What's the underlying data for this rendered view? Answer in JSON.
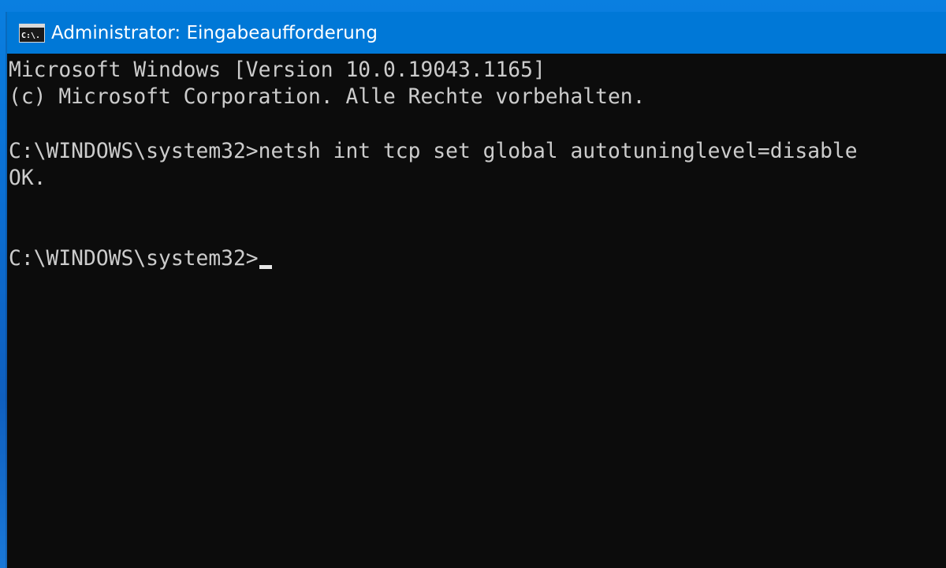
{
  "window": {
    "title": "Administrator: Eingabeaufforderung",
    "title_icon": "cmd-icon",
    "icon_label": "C:\\."
  },
  "console": {
    "lines": [
      "Microsoft Windows [Version 10.0.19043.1165]",
      "(c) Microsoft Corporation. Alle Rechte vorbehalten.",
      "",
      "C:\\WINDOWS\\system32>netsh int tcp set global autotuninglevel=disable",
      "OK.",
      "",
      "",
      "C:\\WINDOWS\\system32>"
    ]
  },
  "colors": {
    "titlebar": "#0078d7",
    "console_bg": "#0c0c0c",
    "console_text": "#cccccc",
    "desktop": "#0b6fd3"
  }
}
